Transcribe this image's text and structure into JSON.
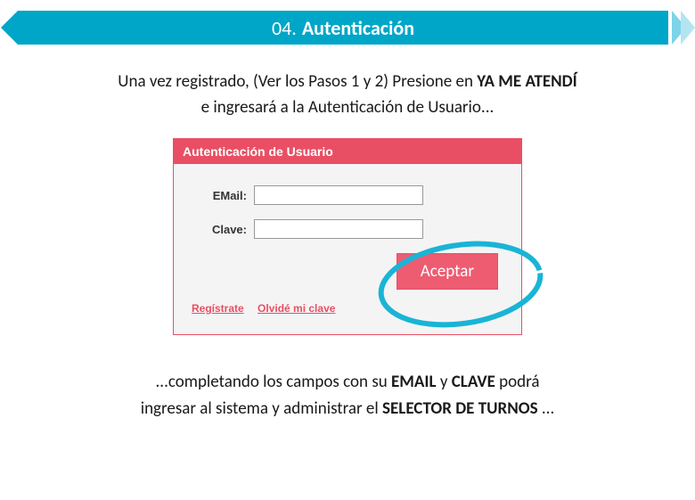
{
  "header": {
    "number": "04.",
    "title": "Autenticación"
  },
  "intro": {
    "part1": "Una vez registrado,  (Ver los Pasos 1 y 2) Presione  en ",
    "bold1": "YA ME ATENDÍ",
    "part2": "e ingresará a la Autenticación de Usuario..."
  },
  "panel": {
    "title": "Autenticación de Usuario",
    "email_label": "EMail:",
    "clave_label": "Clave:",
    "email_value": "",
    "clave_value": "",
    "accept_label": "Aceptar",
    "link_register": "Regístrate",
    "link_forgot": "Olvidé mi clave"
  },
  "outro": {
    "part1": "...completando los campos con  su ",
    "bold1": "EMAIL",
    "part2": " y ",
    "bold2": "CLAVE",
    "part3": " podrá",
    "part4": "ingresar al sistema y administrar el  ",
    "bold3": "SELECTOR DE TURNOS",
    "part5": "..."
  },
  "colors": {
    "accent": "#00a6c7",
    "danger": "#e94f64"
  }
}
